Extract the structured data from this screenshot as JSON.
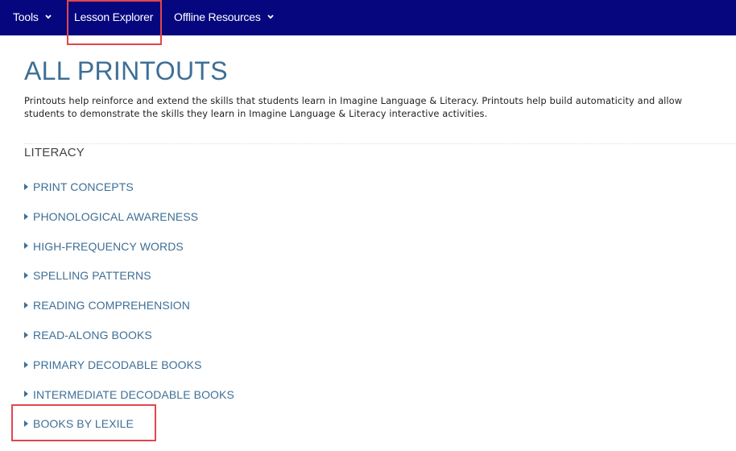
{
  "nav": {
    "tools_label": "Tools",
    "lesson_explorer_label": "Lesson Explorer",
    "offline_resources_label": "Offline Resources"
  },
  "page": {
    "title": "ALL PRINTOUTS",
    "intro": "Printouts help reinforce and extend the skills that students learn in Imagine Language & Literacy. Printouts help build automaticity and allow students to demonstrate the skills they learn in Imagine Language & Literacy interactive activities."
  },
  "literacy": {
    "heading": "LITERACY",
    "items": [
      {
        "label": "PRINT CONCEPTS"
      },
      {
        "label": "PHONOLOGICAL AWARENESS"
      },
      {
        "label": "HIGH-FREQUENCY WORDS"
      },
      {
        "label": "SPELLING PATTERNS"
      },
      {
        "label": "READING COMPREHENSION"
      },
      {
        "label": "READ-ALONG BOOKS"
      },
      {
        "label": "PRIMARY DECODABLE BOOKS"
      },
      {
        "label": "INTERMEDIATE DECODABLE BOOKS"
      },
      {
        "label": "BOOKS BY LEXILE"
      }
    ]
  },
  "colors": {
    "navbar_bg": "#06077e",
    "accent_text": "#3e6f96",
    "highlight_outline": "#e2464d"
  }
}
